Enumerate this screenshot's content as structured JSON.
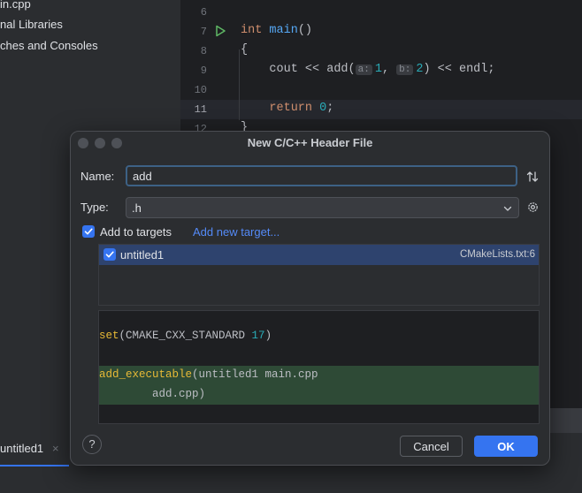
{
  "project_tree": {
    "items": [
      "in.cpp",
      "nal Libraries",
      "ches and Consoles"
    ]
  },
  "editor": {
    "line_numbers": [
      "6",
      "7",
      "8",
      "9",
      "10",
      "11",
      "12"
    ],
    "code": {
      "l7_kw": "int",
      "l7_fn": "main",
      "l7_rest": "()",
      "l8": "{",
      "l9_a": "cout << ",
      "l9_fn": "add",
      "l9_b": "(",
      "l9_hint_a": "a:",
      "l9_val_a": "1",
      "l9_c": ", ",
      "l9_hint_b": "b:",
      "l9_val_b": "2",
      "l9_d": ") << endl;",
      "l11_kw": "return",
      "l11_val": "0",
      "l11_end": ";",
      "l12": "}"
    }
  },
  "bottom": {
    "tab_label": "untitled1",
    "tab_close": "×"
  },
  "dialog": {
    "title": "New C/C++ Header File",
    "name_label": "Name:",
    "name_value": "add",
    "type_label": "Type:",
    "type_value": ".h",
    "add_to_targets_label": "Add to targets",
    "add_new_target_link": "Add new target...",
    "targets": [
      {
        "label": "untitled1",
        "file": "CMakeLists.txt:6",
        "checked": true
      }
    ],
    "preview": {
      "line1_fn": "set",
      "line1_a": "(CMAKE_CXX_STANDARD ",
      "line1_num": "17",
      "line1_b": ")",
      "line2_fn": "add_executable",
      "line2_rest": "(untitled1 main.cpp",
      "line3": "        add.cpp)"
    },
    "help_label": "?",
    "cancel_label": "Cancel",
    "ok_label": "OK"
  },
  "colors": {
    "accent": "#3574f0",
    "selection": "#2e436e",
    "diff_added": "#2e4a36"
  }
}
